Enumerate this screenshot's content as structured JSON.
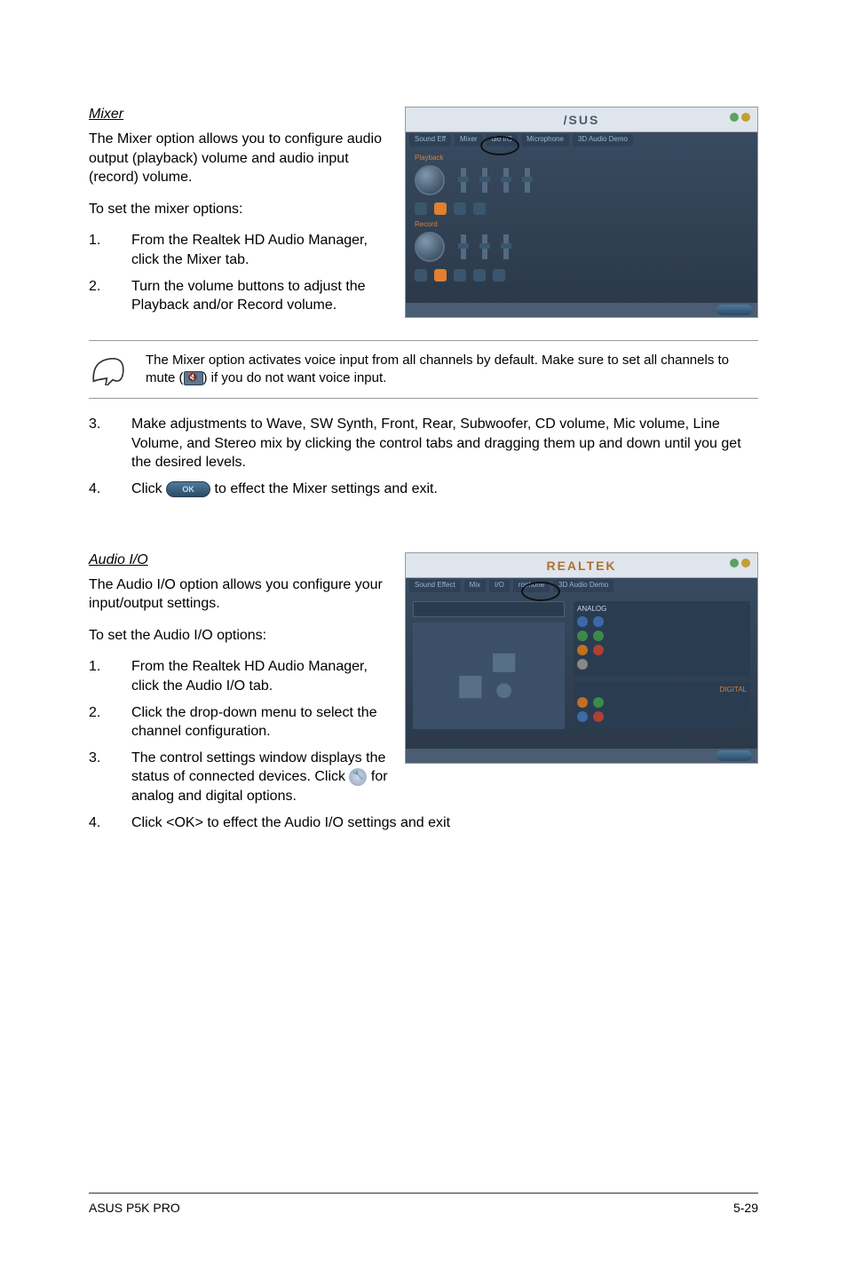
{
  "section1": {
    "title": "Mixer",
    "intro": "The Mixer option allows you to configure audio output (playback) volume and audio input (record) volume.",
    "preSteps": "To set the mixer options:",
    "step1_num": "1.",
    "step1": "From the Realtek HD Audio Manager, click the Mixer tab.",
    "step2_num": "2.",
    "step2": "Turn the volume buttons to adjust the Playback and/or Record volume.",
    "note_a": "The Mixer option activates voice input from all channels by default. Make sure to set all channels to mute (",
    "note_b": ") if you do not want voice input.",
    "step3_num": "3.",
    "step3": "Make adjustments to Wave, SW Synth, Front, Rear, Subwoofer, CD volume, Mic volume, Line Volume, and Stereo mix by clicking the control tabs and dragging them up and down until you get the desired levels.",
    "step4_num": "4.",
    "step4_a": "Click ",
    "step4_b": " to effect the Mixer settings and exit.",
    "ok_label": "OK",
    "ss_brand": "/SUS"
  },
  "section2": {
    "title": "Audio I/O",
    "intro": "The Audio I/O option allows you configure your input/output settings.",
    "preSteps": "To set the Audio I/O options:",
    "step1_num": "1.",
    "step1": "From the Realtek HD Audio Manager, click the Audio I/O tab.",
    "step2_num": "2.",
    "step2": "Click the drop-down menu to select the channel configuration.",
    "step3_num": "3.",
    "step3_a": "The control settings window displays the status of connected devices. Click ",
    "step3_b": " for analog and digital options.",
    "step4_num": "4.",
    "step4": "Click <OK> to effect the Audio I/O settings and exit",
    "ss_brand": "REALTEK",
    "ss_analog": "ANALOG",
    "ss_digital": "DIGITAL"
  },
  "footer": {
    "left": "ASUS P5K PRO",
    "right": "5-29"
  }
}
